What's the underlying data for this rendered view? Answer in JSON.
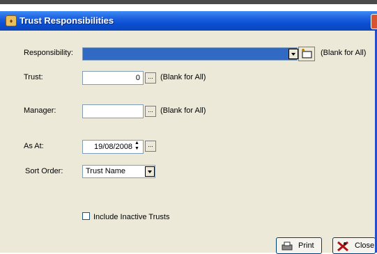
{
  "window": {
    "title": "Trust Responsibilities"
  },
  "form": {
    "responsibility": {
      "label": "Responsibility:",
      "value": "",
      "note": "(Blank for All)"
    },
    "trust": {
      "label": "Trust:",
      "value": "0",
      "note": "(Blank for All)"
    },
    "manager": {
      "label": "Manager:",
      "value": "",
      "note": "(Blank for All)"
    },
    "as_at": {
      "label": "As At:",
      "value": "19/08/2008"
    },
    "sort_order": {
      "label": "Sort Order:",
      "value": "Trust Name"
    },
    "include_inactive": {
      "label": "Include Inactive Trusts",
      "checked": false
    },
    "browse_glyph": "..."
  },
  "buttons": {
    "print": "Print",
    "close": "Close"
  }
}
